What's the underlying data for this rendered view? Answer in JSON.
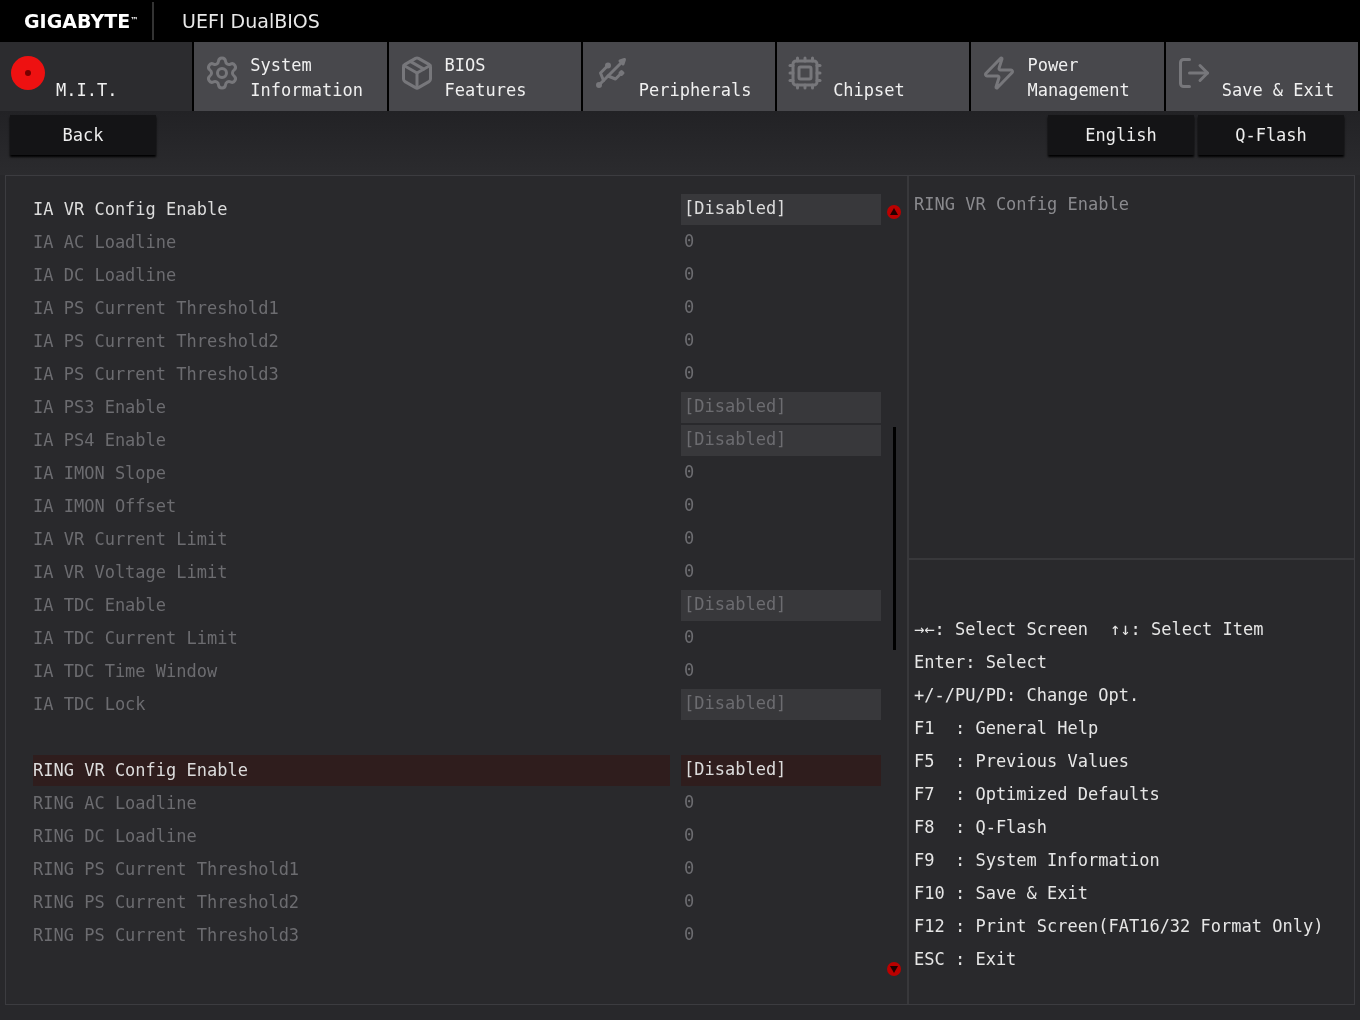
{
  "header": {
    "brand": "GIGABYTE",
    "brand_mark": "™",
    "title": "UEFI DualBIOS"
  },
  "tabs": [
    {
      "label": "M.I.T.",
      "selected": true
    },
    {
      "label": "System\nInformation",
      "selected": false
    },
    {
      "label": "BIOS\nFeatures",
      "selected": false
    },
    {
      "label": "Peripherals",
      "selected": false
    },
    {
      "label": "Chipset",
      "selected": false
    },
    {
      "label": "Power\nManagement",
      "selected": false
    },
    {
      "label": "Save & Exit",
      "selected": false
    }
  ],
  "back_button": "Back",
  "right_buttons": [
    "English",
    "Q-Flash"
  ],
  "settings": [
    [
      {
        "label": "IA VR Config Enable",
        "value": "[Disabled]",
        "kind": "option",
        "disabled": false,
        "selected": false
      },
      {
        "label": "IA AC Loadline",
        "value": "0",
        "kind": "number",
        "disabled": true,
        "selected": false
      },
      {
        "label": "IA DC Loadline",
        "value": "0",
        "kind": "number",
        "disabled": true,
        "selected": false
      },
      {
        "label": "IA PS Current Threshold1",
        "value": "0",
        "kind": "number",
        "disabled": true,
        "selected": false
      },
      {
        "label": "IA PS Current Threshold2",
        "value": "0",
        "kind": "number",
        "disabled": true,
        "selected": false
      },
      {
        "label": "IA PS Current Threshold3",
        "value": "0",
        "kind": "number",
        "disabled": true,
        "selected": false
      },
      {
        "label": "IA PS3 Enable",
        "value": "[Disabled]",
        "kind": "option",
        "disabled": true,
        "selected": false
      },
      {
        "label": "IA PS4 Enable",
        "value": "[Disabled]",
        "kind": "option",
        "disabled": true,
        "selected": false
      },
      {
        "label": "IA IMON Slope",
        "value": "0",
        "kind": "number",
        "disabled": true,
        "selected": false
      },
      {
        "label": "IA IMON Offset",
        "value": "0",
        "kind": "number",
        "disabled": true,
        "selected": false
      },
      {
        "label": "IA VR Current Limit",
        "value": "0",
        "kind": "number",
        "disabled": true,
        "selected": false
      },
      {
        "label": "IA VR Voltage Limit",
        "value": "0",
        "kind": "number",
        "disabled": true,
        "selected": false
      },
      {
        "label": "IA TDC Enable",
        "value": "[Disabled]",
        "kind": "option",
        "disabled": true,
        "selected": false
      },
      {
        "label": "IA TDC Current Limit",
        "value": "0",
        "kind": "number",
        "disabled": true,
        "selected": false
      },
      {
        "label": "IA TDC Time Window",
        "value": "0",
        "kind": "number",
        "disabled": true,
        "selected": false
      },
      {
        "label": "IA TDC Lock",
        "value": "[Disabled]",
        "kind": "option",
        "disabled": true,
        "selected": false
      }
    ],
    [
      {
        "label": "RING VR Config Enable",
        "value": "[Disabled]",
        "kind": "option",
        "disabled": false,
        "selected": true
      },
      {
        "label": "RING AC Loadline",
        "value": "0",
        "kind": "number",
        "disabled": true,
        "selected": false
      },
      {
        "label": "RING DC Loadline",
        "value": "0",
        "kind": "number",
        "disabled": true,
        "selected": false
      },
      {
        "label": "RING PS Current Threshold1",
        "value": "0",
        "kind": "number",
        "disabled": true,
        "selected": false
      },
      {
        "label": "RING PS Current Threshold2",
        "value": "0",
        "kind": "number",
        "disabled": true,
        "selected": false
      },
      {
        "label": "RING PS Current Threshold3",
        "value": "0",
        "kind": "number",
        "disabled": true,
        "selected": false
      }
    ]
  ],
  "description": "RING VR Config Enable",
  "help": [
    [
      "→←: Select Screen",
      "↑↓: Select Item"
    ],
    [
      "Enter: Select"
    ],
    [
      "+/-/PU/PD: Change Opt."
    ],
    [
      "F1  : General Help"
    ],
    [
      "F5  : Previous Values"
    ],
    [
      "F7  : Optimized Defaults"
    ],
    [
      "F8  : Q-Flash"
    ],
    [
      "F9  : System Information"
    ],
    [
      "F10 : Save & Exit"
    ],
    [
      "F12 : Print Screen(FAT16/32 Format Only)"
    ],
    [
      "ESC : Exit"
    ]
  ]
}
